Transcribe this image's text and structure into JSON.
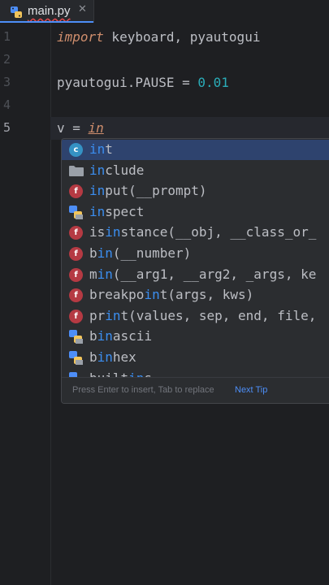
{
  "tab": {
    "filename": "main.py",
    "close_glyph": "✕",
    "icon": "python-file-icon"
  },
  "gutter": {
    "line_numbers": [
      "1",
      "2",
      "3",
      "4",
      "5"
    ]
  },
  "code": {
    "line1": {
      "keyword": "import",
      "rest": " keyboard, pyautogui"
    },
    "line3": {
      "text": "pyautogui.PAUSE = ",
      "number": "0.01"
    },
    "line5": {
      "text": "v = ",
      "typed": "in"
    }
  },
  "completion": {
    "items": [
      {
        "icon": "class-icon",
        "match": "in",
        "rest": "t"
      },
      {
        "icon": "folder-icon",
        "match": "in",
        "rest": "clude"
      },
      {
        "icon": "function-icon",
        "match": "in",
        "rest": "put(__prompt)"
      },
      {
        "icon": "python-module-icon",
        "match": "in",
        "rest": "spect"
      },
      {
        "icon": "function-icon",
        "pre": "is",
        "match": "in",
        "rest": "stance(__obj, __class_or_"
      },
      {
        "icon": "function-icon",
        "pre": "b",
        "match": "in",
        "rest": "(__number)"
      },
      {
        "icon": "function-icon",
        "pre": "m",
        "match": "in",
        "rest": "(__arg1, __arg2, _args, ke"
      },
      {
        "icon": "function-icon",
        "pre": "breakpo",
        "match": "in",
        "rest": "t(args, kws)"
      },
      {
        "icon": "function-icon",
        "pre": "pr",
        "match": "in",
        "rest": "t(values, sep, end, file,"
      },
      {
        "icon": "python-module-icon",
        "pre": "b",
        "match": "in",
        "rest": "ascii"
      },
      {
        "icon": "python-module-icon",
        "pre": "b",
        "match": "in",
        "rest": "hex"
      },
      {
        "icon": "python-module-icon",
        "pre": "built",
        "match": "in",
        "rest": "s"
      }
    ],
    "hint": "Press Enter to insert, Tab to replace",
    "next_tip": "Next Tip"
  },
  "colors": {
    "background": "#1e1f22",
    "keyword": "#cf8e6d",
    "number": "#2aacb8",
    "match": "#3b8ef0",
    "selection": "#2e436e"
  }
}
